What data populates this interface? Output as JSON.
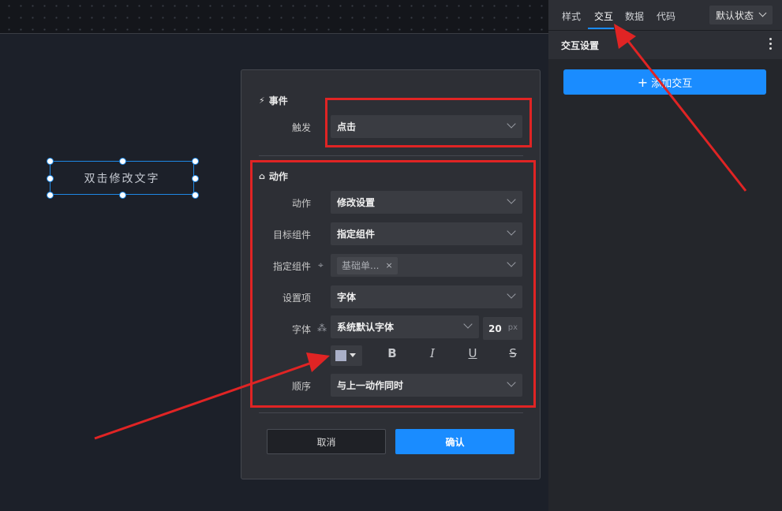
{
  "canvas": {
    "element_text": "双击修改文字"
  },
  "modal": {
    "event_section": {
      "title": "事件",
      "trigger_label": "触发",
      "trigger_value": "点击"
    },
    "action_section": {
      "title": "动作",
      "action_label": "动作",
      "action_value": "修改设置",
      "target_label": "目标组件",
      "target_value": "指定组件",
      "specific_label": "指定组件",
      "specific_tag": "基础单...",
      "setting_label": "设置项",
      "setting_value": "字体",
      "font_label": "字体",
      "font_value": "系统默认字体",
      "font_size": "20",
      "font_unit": "px",
      "order_label": "顺序",
      "order_value": "与上一动作同时"
    },
    "format_buttons": {
      "bold": "B",
      "italic": "I",
      "underline": "U",
      "strike": "S"
    },
    "color_value": "#aab0c8",
    "cancel_label": "取消",
    "ok_label": "确认"
  },
  "right_panel": {
    "tabs": [
      "样式",
      "交互",
      "数据",
      "代码"
    ],
    "active_tab": "交互",
    "state_select": "默认状态",
    "section_title": "交互设置",
    "add_button": "添加交互",
    "add_icon": "+"
  },
  "colors": {
    "accent": "#1a8cff",
    "annotation": "#e02424",
    "selection": "#1e88e5"
  }
}
